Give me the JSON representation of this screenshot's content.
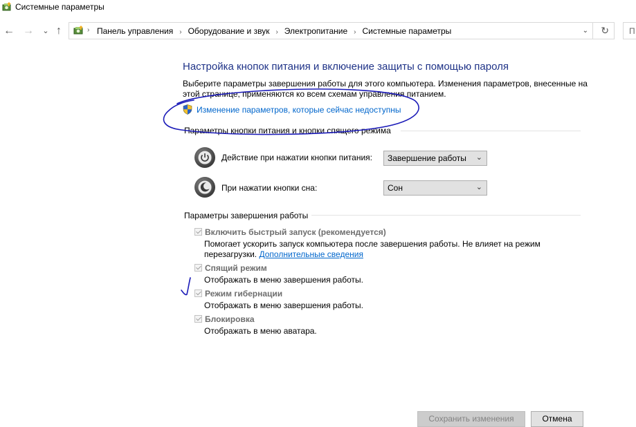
{
  "window": {
    "title": "Системные параметры"
  },
  "nav": {
    "back_glyph": "←",
    "forward_glyph": "→",
    "recent_glyph": "⌄",
    "up_glyph": "↑",
    "breadcrumbs": [
      "Панель управления",
      "Оборудование и звук",
      "Электропитание",
      "Системные параметры"
    ],
    "separator_glyph": "›",
    "dropdown_glyph": "⌄",
    "refresh_glyph": "↻",
    "search_glyph": "П"
  },
  "main": {
    "title": "Настройка кнопок питания и включение защиты с помощью пароля",
    "description": "Выберите параметры завершения работы для этого компьютера. Изменения параметров, внесенные на этой странице, применяются ко всем схемам управления питанием.",
    "uac_link": "Изменение параметров, которые сейчас недоступны",
    "power_section": {
      "header": "Параметры кнопки питания и кнопки спящего режима",
      "rows": [
        {
          "label": "Действие при нажатии кнопки питания:",
          "value": "Завершение работы",
          "icon": "power-icon"
        },
        {
          "label": "При нажатии кнопки сна:",
          "value": "Сон",
          "icon": "sleep-icon"
        }
      ],
      "dropdown_arrow": "⌄"
    },
    "shutdown_section": {
      "header": "Параметры завершения работы",
      "items": [
        {
          "label": "Включить быстрый запуск (рекомендуется)",
          "checked": true,
          "description": "Помогает ускорить запуск компьютера после завершения работы. Не влияет на режим перезагрузки.",
          "link": "Дополнительные сведения"
        },
        {
          "label": "Спящий режим",
          "checked": true,
          "description": "Отображать в меню завершения работы."
        },
        {
          "label": "Режим гибернации",
          "checked": true,
          "description": "Отображать в меню завершения работы."
        },
        {
          "label": "Блокировка",
          "checked": true,
          "description": "Отображать в меню аватара."
        }
      ]
    }
  },
  "footer": {
    "save_label": "Сохранить изменения",
    "cancel_label": "Отмена"
  },
  "colors": {
    "title_blue": "#1e3287",
    "link_blue": "#0066cc",
    "annotation_ink": "#1a1ab8"
  }
}
